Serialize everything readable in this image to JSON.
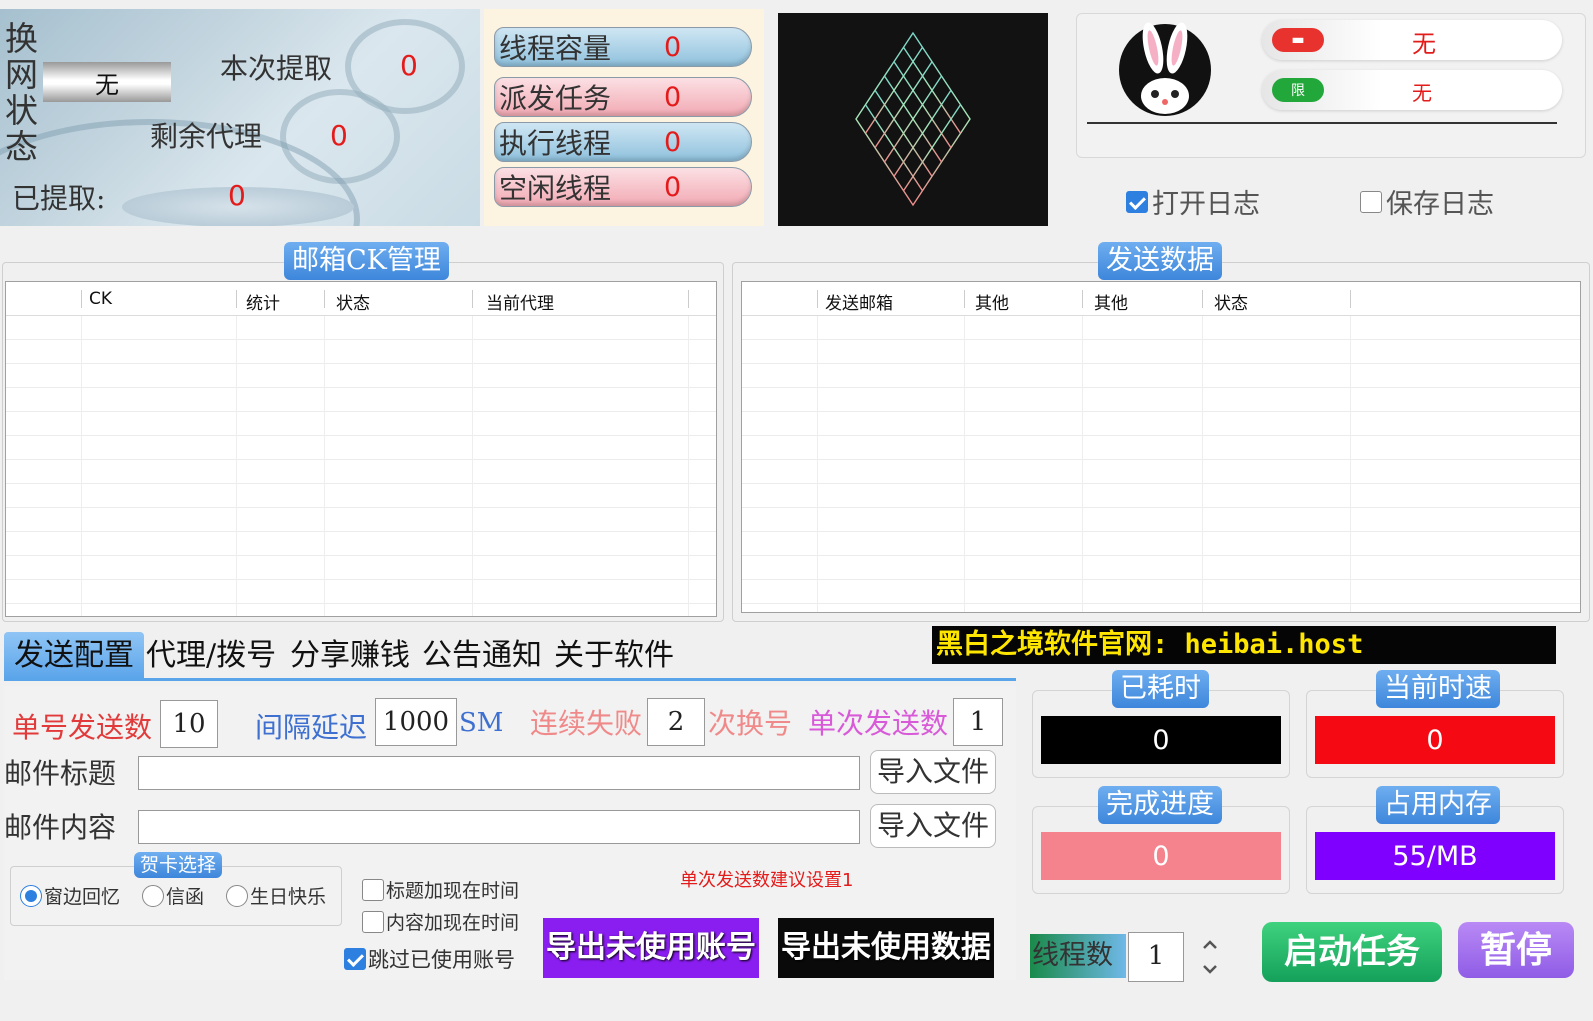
{
  "net_panel": {
    "vertical_label": "换网状态",
    "net_status": "无",
    "this_fetch_label": "本次提取",
    "this_fetch_value": "0",
    "remaining_proxy_label": "剩余代理",
    "remaining_proxy_value": "0",
    "fetched_label": "已提取:",
    "fetched_value": "0"
  },
  "threads": {
    "capacity_label": "线程容量",
    "capacity_value": "0",
    "dispatch_label": "派发任务",
    "dispatch_value": "0",
    "running_label": "执行线程",
    "running_value": "0",
    "idle_label": "空闲线程",
    "idle_value": "0"
  },
  "user": {
    "row1_value": "无",
    "row2_icon": "限",
    "row2_value": "无",
    "open_log_label": "打开日志",
    "open_log_checked": true,
    "save_log_label": "保存日志",
    "save_log_checked": false
  },
  "ck_table": {
    "title": "邮箱CK管理",
    "columns": [
      "CK",
      "统计",
      "状态",
      "当前代理"
    ]
  },
  "send_table": {
    "title": "发送数据",
    "columns": [
      "发送邮箱",
      "其他",
      "其他",
      "状态"
    ]
  },
  "tabs": [
    "发送配置",
    "代理/拨号",
    "分享赚钱",
    "公告通知",
    "关于软件"
  ],
  "website_banner": "黑白之境软件官网: heibai.host",
  "config": {
    "per_account_label": "单号发送数",
    "per_account_value": "10",
    "interval_label": "间隔延迟",
    "interval_value": "1000",
    "interval_unit": "SM",
    "fail_label": "连续失败",
    "fail_value": "2",
    "fail_suffix": "次换号",
    "batch_label": "单次发送数",
    "batch_value": "1",
    "subject_label": "邮件标题",
    "subject_value": "",
    "content_label": "邮件内容",
    "content_value": "",
    "import_file_label": "导入文件",
    "card_group_title": "贺卡选择",
    "card_options": [
      "窗边回忆",
      "信函",
      "生日快乐"
    ],
    "card_selected": 0,
    "hint": "单次发送数建议设置1",
    "title_add_time_label": "标题加现在时间",
    "content_add_time_label": "内容加现在时间",
    "skip_used_label": "跳过已使用账号",
    "export_accounts_label": "导出未使用账号",
    "export_data_label": "导出未使用数据"
  },
  "stats": {
    "elapsed_label": "已耗时",
    "elapsed_value": "0",
    "speed_label": "当前时速",
    "speed_value": "0",
    "progress_label": "完成进度",
    "progress_value": "0",
    "memory_label": "占用内存",
    "memory_value": "55/MB"
  },
  "controls": {
    "threads_label": "线程数",
    "threads_value": "1",
    "start_label": "启动任务",
    "pause_label": "暂停"
  },
  "colors": {
    "accent_blue": "#3d86db",
    "red_value": "#e41b1b",
    "start_green": "#14a05a",
    "pause_purple": "#8f5ce6",
    "export_purple": "#8a1df0"
  }
}
